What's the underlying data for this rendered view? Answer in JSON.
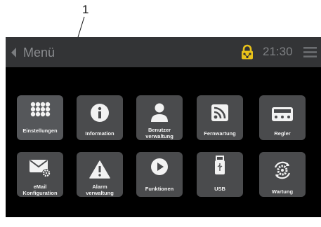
{
  "callout": {
    "number": "1"
  },
  "topbar": {
    "menu_label": "Menü",
    "time": "21:30"
  },
  "tiles": [
    {
      "label": "Einstellungen",
      "icon": "keypad-grid-icon"
    },
    {
      "label": "Information",
      "icon": "info-icon"
    },
    {
      "label": "Benutzer\nverwaltung",
      "icon": "user-icon"
    },
    {
      "label": "Fernwartung",
      "icon": "remote-signal-icon"
    },
    {
      "label": "Regler",
      "icon": "controller-display-icon"
    },
    {
      "label": "eMail\nKonfiguration",
      "icon": "mail-gear-icon"
    },
    {
      "label": "Alarm\nverwaltung",
      "icon": "alarm-warning-icon"
    },
    {
      "label": "Funktionen",
      "icon": "play-icon"
    },
    {
      "label": "USB",
      "icon": "usb-stick-icon"
    },
    {
      "label": "Wartung",
      "icon": "maintenance-gear-icon"
    }
  ],
  "colors": {
    "lock": "#e8c21a",
    "tile": "#4a4b4d",
    "topbar": "#333436"
  }
}
